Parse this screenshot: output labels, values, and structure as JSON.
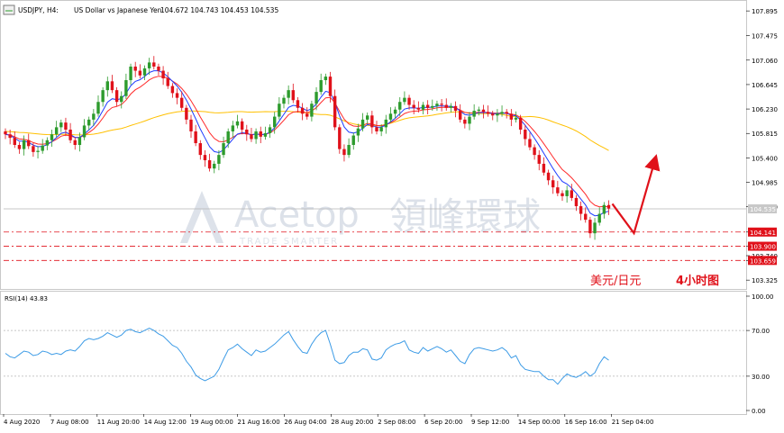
{
  "header": {
    "symbol": "USDJPY, H4:",
    "description": "US Dollar vs Japanese Yen",
    "ohlc": "104.672 104.743 104.453 104.535"
  },
  "watermark": {
    "brand": "Acetop",
    "brand_cn": "領峰環球",
    "tagline": "TRADE SMARTER"
  },
  "caption": {
    "pair": "美元/日元",
    "timeframe": "4小时图",
    "color": "#e0111a"
  },
  "colors": {
    "bull": "#2d9b2d",
    "bear": "#e0111a",
    "ma_fast": "#1e3cff",
    "ma_mid": "#ff2a2a",
    "ma_slow": "#ffc000",
    "rsi": "#3c9be6",
    "levels": "#e0111a",
    "arrow": "#e0111a"
  },
  "chart_data": [
    {
      "type": "candlestick",
      "name": "USDJPY, H4",
      "ylim": [
        103.19,
        108.05
      ],
      "y_ticks": [
        "107.895",
        "107.475",
        "107.060",
        "106.645",
        "106.230",
        "105.815",
        "105.400",
        "104.985",
        "104.570",
        "104.141",
        "103.900",
        "103.740",
        "103.659",
        "103.325"
      ],
      "x_ticks": [
        "4 Aug 2020",
        "7 Aug 08:00",
        "11 Aug 20:00",
        "14 Aug 12:00",
        "19 Aug 00:00",
        "21 Aug 16:00",
        "26 Aug 04:00",
        "28 Aug 20:00",
        "2 Sep 08:00",
        "6 Sep 20:00",
        "9 Sep 12:00",
        "14 Sep 00:00",
        "16 Sep 16:00",
        "21 Sep 04:00"
      ],
      "current_price": "104.535",
      "current_price_value": 104.535,
      "levels": [
        {
          "label": "104.141",
          "value": 104.141
        },
        {
          "label": "103.900",
          "value": 103.9
        },
        {
          "label": "103.659",
          "value": 103.659
        }
      ],
      "close_series": [
        105.8,
        105.74,
        105.62,
        105.55,
        105.7,
        105.6,
        105.5,
        105.52,
        105.61,
        105.7,
        105.8,
        105.92,
        106.0,
        105.88,
        105.7,
        105.62,
        105.75,
        105.95,
        106.05,
        106.15,
        106.35,
        106.55,
        106.7,
        106.55,
        106.35,
        106.45,
        106.72,
        106.95,
        106.88,
        106.8,
        106.92,
        107.02,
        106.95,
        106.88,
        106.75,
        106.62,
        106.5,
        106.42,
        106.25,
        106.05,
        105.85,
        105.65,
        105.45,
        105.36,
        105.22,
        105.3,
        105.45,
        105.65,
        105.85,
        105.95,
        106.02,
        105.88,
        105.8,
        105.72,
        105.85,
        105.76,
        105.82,
        105.92,
        106.1,
        106.32,
        106.42,
        106.55,
        106.38,
        106.25,
        106.15,
        106.1,
        106.32,
        106.52,
        106.72,
        106.78,
        106.45,
        105.92,
        105.55,
        105.45,
        105.62,
        105.78,
        105.9,
        106.05,
        106.12,
        105.92,
        105.85,
        105.92,
        106.05,
        106.15,
        106.22,
        106.35,
        106.42,
        106.3,
        106.25,
        106.22,
        106.3,
        106.25,
        106.28,
        106.32,
        106.3,
        106.25,
        106.28,
        106.2,
        106.05,
        105.98,
        106.1,
        106.2,
        106.22,
        106.18,
        106.15,
        106.12,
        106.15,
        106.18,
        106.15,
        106.05,
        106.08,
        105.88,
        105.72,
        105.58,
        105.45,
        105.3,
        105.15,
        105.02,
        104.9,
        104.8,
        104.75,
        104.85,
        104.72,
        104.58,
        104.45,
        104.35,
        104.12,
        104.3,
        104.45,
        104.6,
        104.54
      ],
      "rsi": {
        "label": "RSI(14) 43.83",
        "ylim": [
          0,
          100
        ],
        "y_ticks": [
          "100.00",
          "70.00",
          "30.00",
          "0.00"
        ],
        "levels": [
          70,
          30
        ],
        "values": [
          50,
          47,
          46,
          49,
          52,
          51,
          48,
          49,
          52,
          51,
          49,
          50,
          49,
          52,
          53,
          52,
          56,
          61,
          63,
          62,
          63,
          65,
          68,
          66,
          64,
          66,
          70,
          71,
          69,
          68,
          70,
          72,
          70,
          67,
          65,
          61,
          57,
          55,
          50,
          43,
          38,
          31,
          28,
          26,
          28,
          30,
          36,
          45,
          53,
          55,
          58,
          54,
          51,
          48,
          53,
          51,
          52,
          55,
          58,
          62,
          66,
          69,
          62,
          56,
          51,
          50,
          58,
          64,
          68,
          70,
          58,
          44,
          41,
          42,
          48,
          51,
          51,
          54,
          53,
          45,
          44,
          46,
          53,
          56,
          58,
          59,
          61,
          53,
          51,
          50,
          55,
          52,
          54,
          56,
          54,
          51,
          53,
          48,
          43,
          41,
          49,
          54,
          55,
          54,
          53,
          52,
          53,
          55,
          52,
          46,
          48,
          40,
          36,
          35,
          34,
          34,
          30,
          27,
          27,
          23,
          28,
          32,
          30,
          29,
          31,
          34,
          30,
          33,
          41,
          47,
          44
        ]
      },
      "forecast_arrow": "down to ~104.1, then up toward ~105.4"
    }
  ]
}
